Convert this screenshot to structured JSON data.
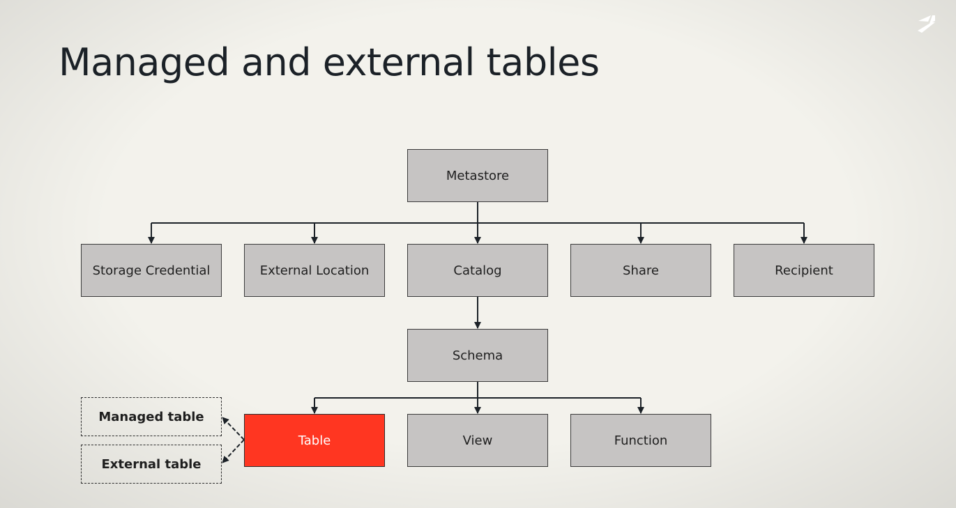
{
  "slide": {
    "title": "Managed and external tables"
  },
  "nodes": {
    "metastore": "Metastore",
    "storage_credential": "Storage Credential",
    "external_location": "External Location",
    "catalog": "Catalog",
    "share": "Share",
    "recipient": "Recipient",
    "schema": "Schema",
    "table": "Table",
    "view": "View",
    "function": "Function",
    "managed_table": "Managed table",
    "external_table": "External table"
  },
  "colors": {
    "background": "#f3f2ec",
    "box_fill": "#c6c4c3",
    "highlight": "#ff3621",
    "line": "#1b2127"
  },
  "icons": {
    "logo": "databricks-logo-icon"
  }
}
